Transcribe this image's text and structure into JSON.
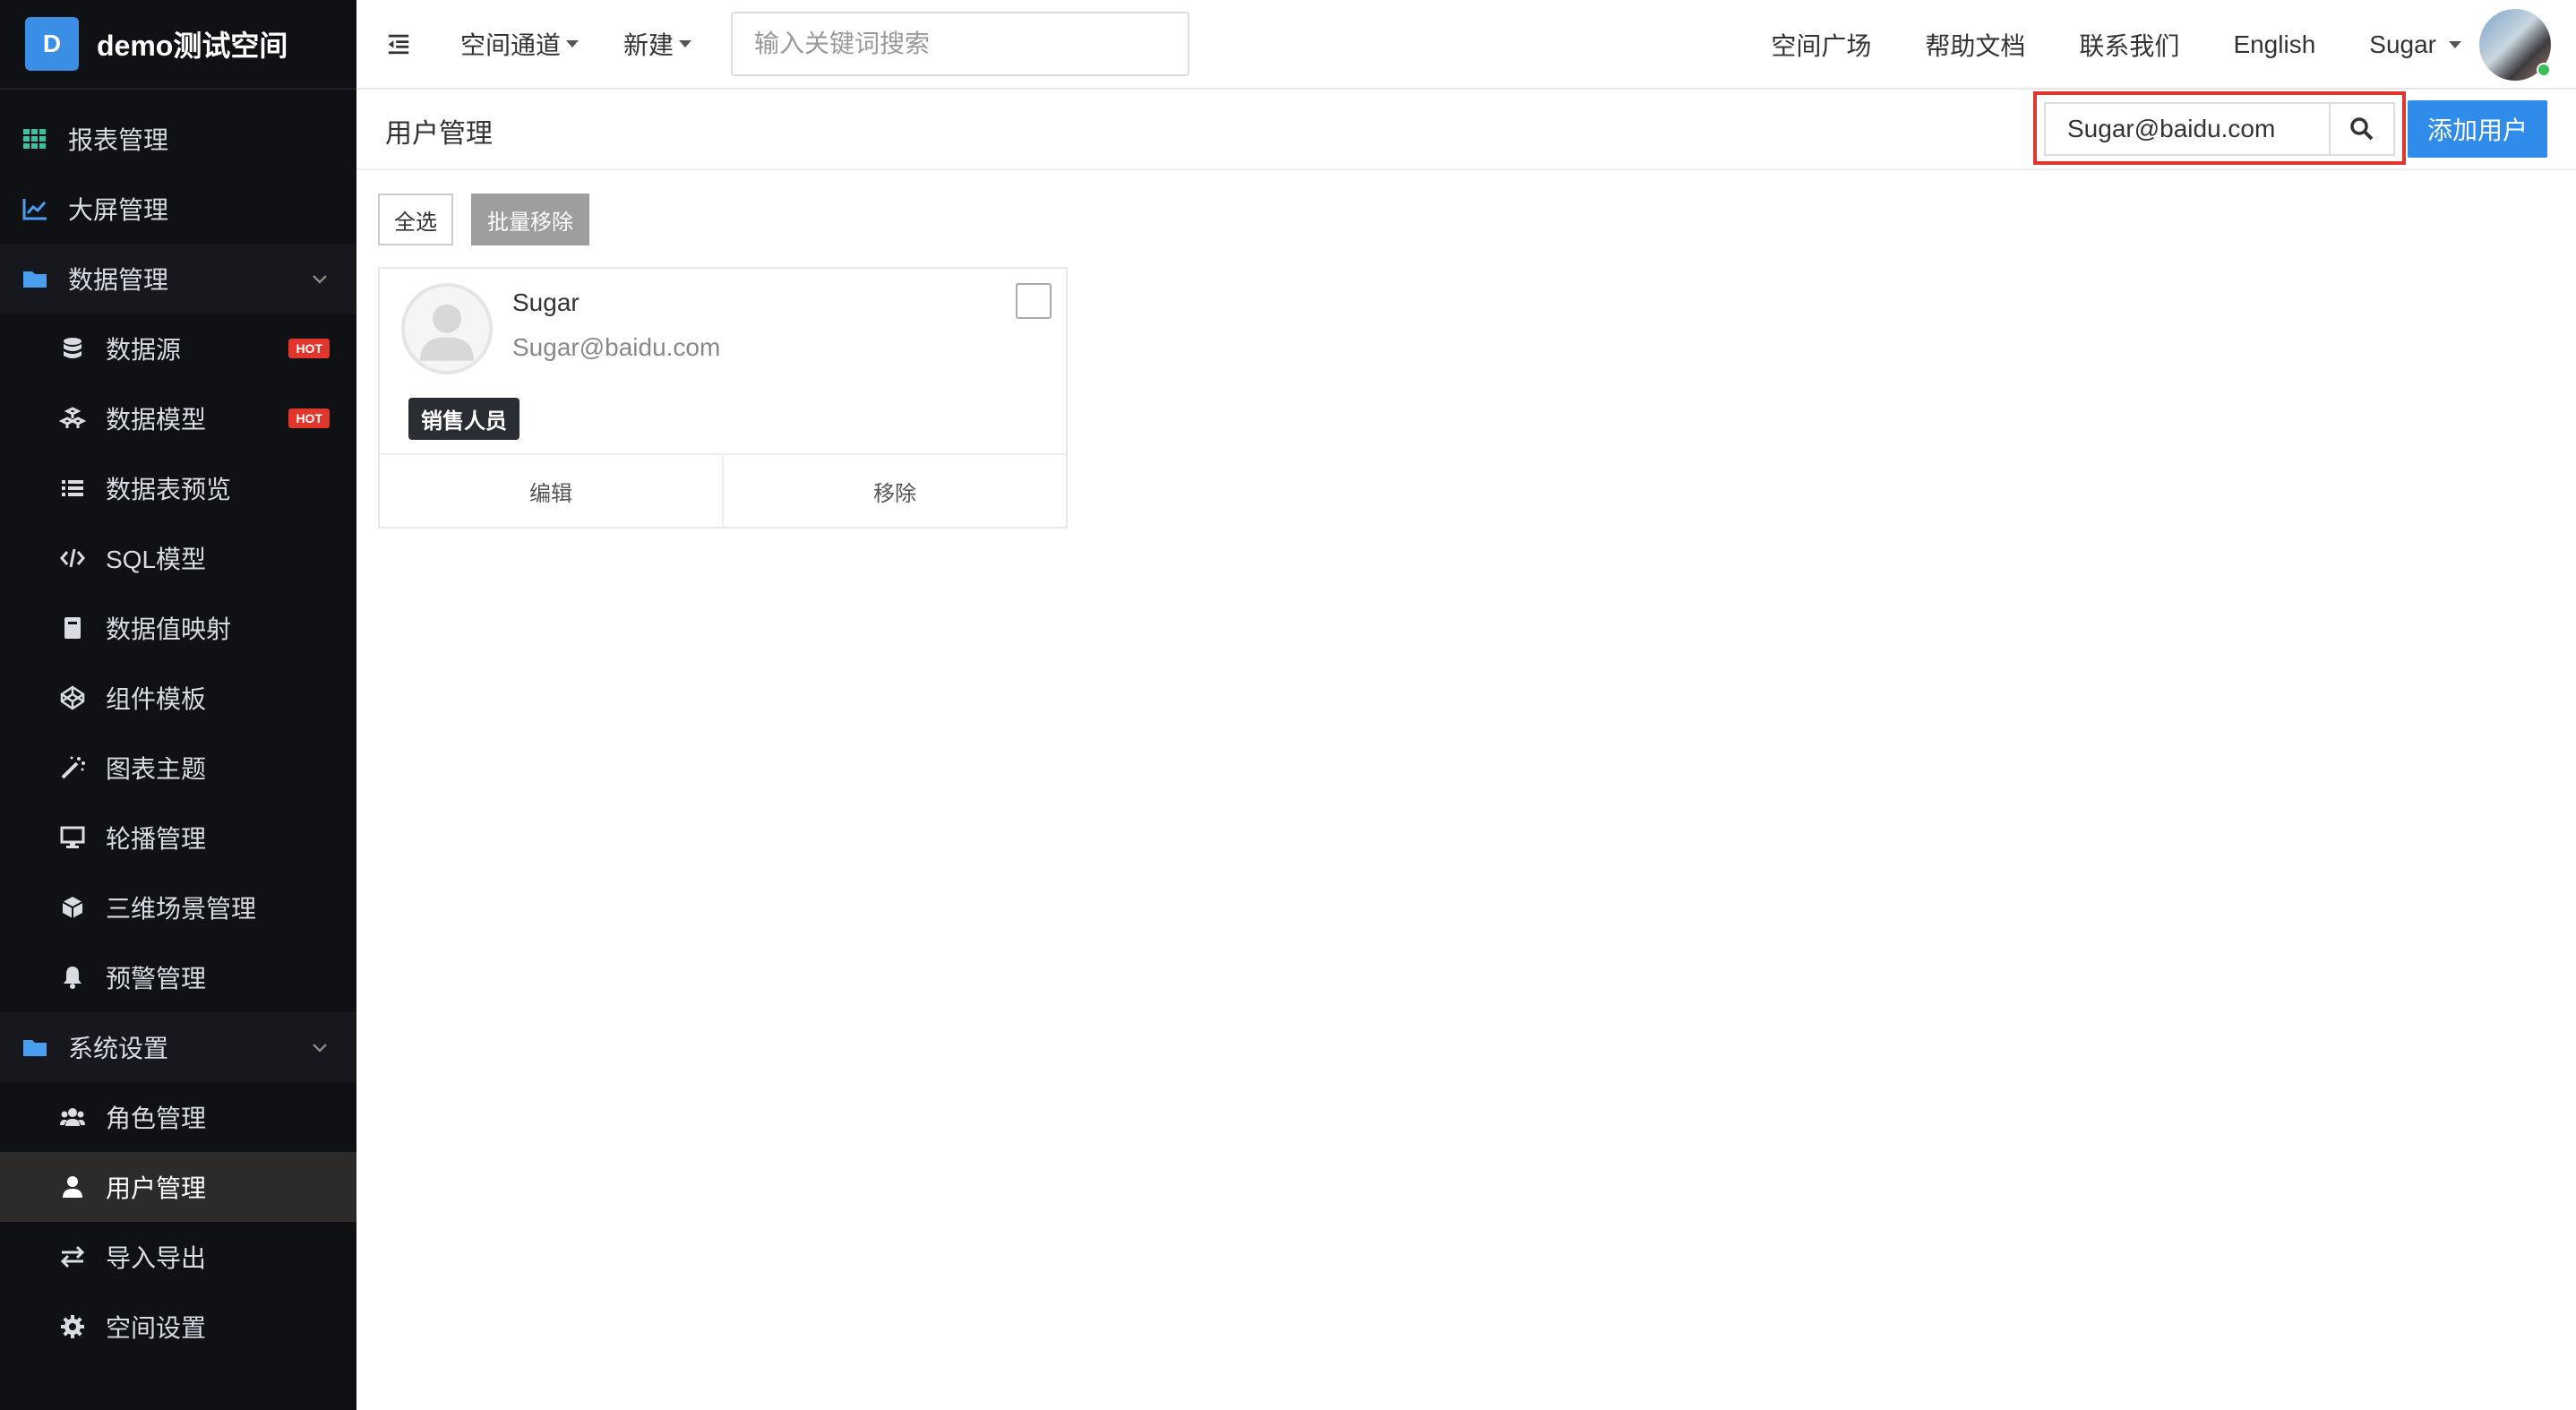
{
  "brand": {
    "logo_letter": "D",
    "title": "demo测试空间"
  },
  "sidebar": {
    "items": [
      {
        "label": "报表管理",
        "icon": "grid-icon"
      },
      {
        "label": "大屏管理",
        "icon": "line-chart-icon"
      },
      {
        "label": "数据管理",
        "icon": "folder-icon"
      },
      {
        "label": "数据源",
        "icon": "database-icon",
        "badge": "HOT"
      },
      {
        "label": "数据模型",
        "icon": "cubes-icon",
        "badge": "HOT"
      },
      {
        "label": "数据表预览",
        "icon": "list-icon"
      },
      {
        "label": "SQL模型",
        "icon": "code-icon"
      },
      {
        "label": "数据值映射",
        "icon": "book-icon"
      },
      {
        "label": "组件模板",
        "icon": "codepen-icon"
      },
      {
        "label": "图表主题",
        "icon": "magic-wand-icon"
      },
      {
        "label": "轮播管理",
        "icon": "desktop-icon"
      },
      {
        "label": "三维场景管理",
        "icon": "cube-icon"
      },
      {
        "label": "预警管理",
        "icon": "bell-icon"
      },
      {
        "label": "系统设置",
        "icon": "folder-icon"
      },
      {
        "label": "角色管理",
        "icon": "users-icon"
      },
      {
        "label": "用户管理",
        "icon": "user-icon"
      },
      {
        "label": "导入导出",
        "icon": "exchange-icon"
      },
      {
        "label": "空间设置",
        "icon": "gear-icon"
      }
    ]
  },
  "topbar": {
    "space_channel": "空间通道",
    "new": "新建",
    "search_placeholder": "输入关键词搜索",
    "links": [
      "空间广场",
      "帮助文档",
      "联系我们",
      "English"
    ],
    "user_name": "Sugar"
  },
  "page": {
    "title": "用户管理",
    "filter_value": "Sugar@baidu.com",
    "add_user": "添加用户",
    "select_all": "全选",
    "batch_remove": "批量移除"
  },
  "users": [
    {
      "name": "Sugar",
      "email": "Sugar@baidu.com",
      "role": "销售人员",
      "edit": "编辑",
      "remove": "移除"
    }
  ],
  "colors": {
    "sidebar_bg": "#0f1115",
    "primary": "#2f8ceb",
    "hot_badge": "#e0362c",
    "highlight": "#e0362c"
  }
}
